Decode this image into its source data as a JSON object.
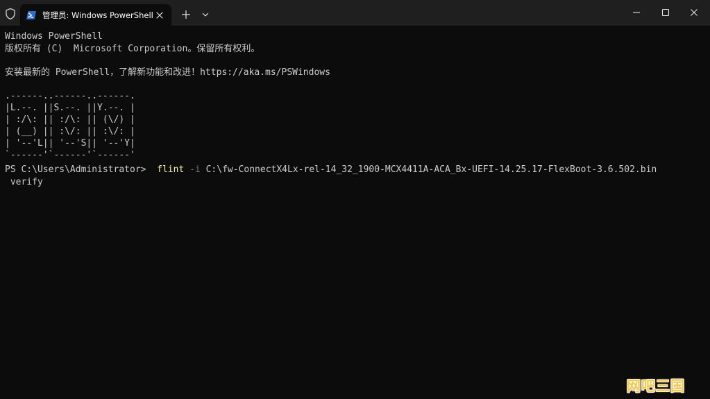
{
  "tab": {
    "title": "管理员: Windows PowerShell",
    "icon": "powershell-icon"
  },
  "titlebar": {
    "shield_icon": "shield-icon",
    "new_tab_icon": "plus-icon",
    "dropdown_icon": "chevron-down-icon",
    "minimize_icon": "minimize-icon",
    "maximize_icon": "maximize-icon",
    "close_icon": "close-icon"
  },
  "terminal": {
    "lines": [
      "Windows PowerShell",
      "版权所有 (C)  Microsoft Corporation。保留所有权利。",
      "",
      "安装最新的 PowerShell，了解新功能和改进！https://aka.ms/PSWindows",
      "",
      ".------..------..------.",
      "|L.--. ||S.--. ||Y.--. |",
      "| :/\\: || :/\\: || (\\/) |",
      "| (__) || :\\/: || :\\/: |",
      "| '--'L|| '--'S|| '--'Y|",
      "`------'`------'`------'"
    ],
    "prompt": "PS C:\\Users\\Administrator> ",
    "command": "flint",
    "param": "-i",
    "argument": "C:\\fw-ConnectX4Lx-rel-14_32_1900-MCX4411A-ACA_Bx-UEFI-14.25.17-FlexBoot-3.6.502.bin",
    "continuation": " verify"
  },
  "colors": {
    "background": "#0c0c0c",
    "titlebar": "#1f1f1f",
    "text": "#cccccc",
    "command": "#f9f1a5",
    "parameter": "#767676"
  },
  "watermark": {
    "text": "网吧三国"
  }
}
